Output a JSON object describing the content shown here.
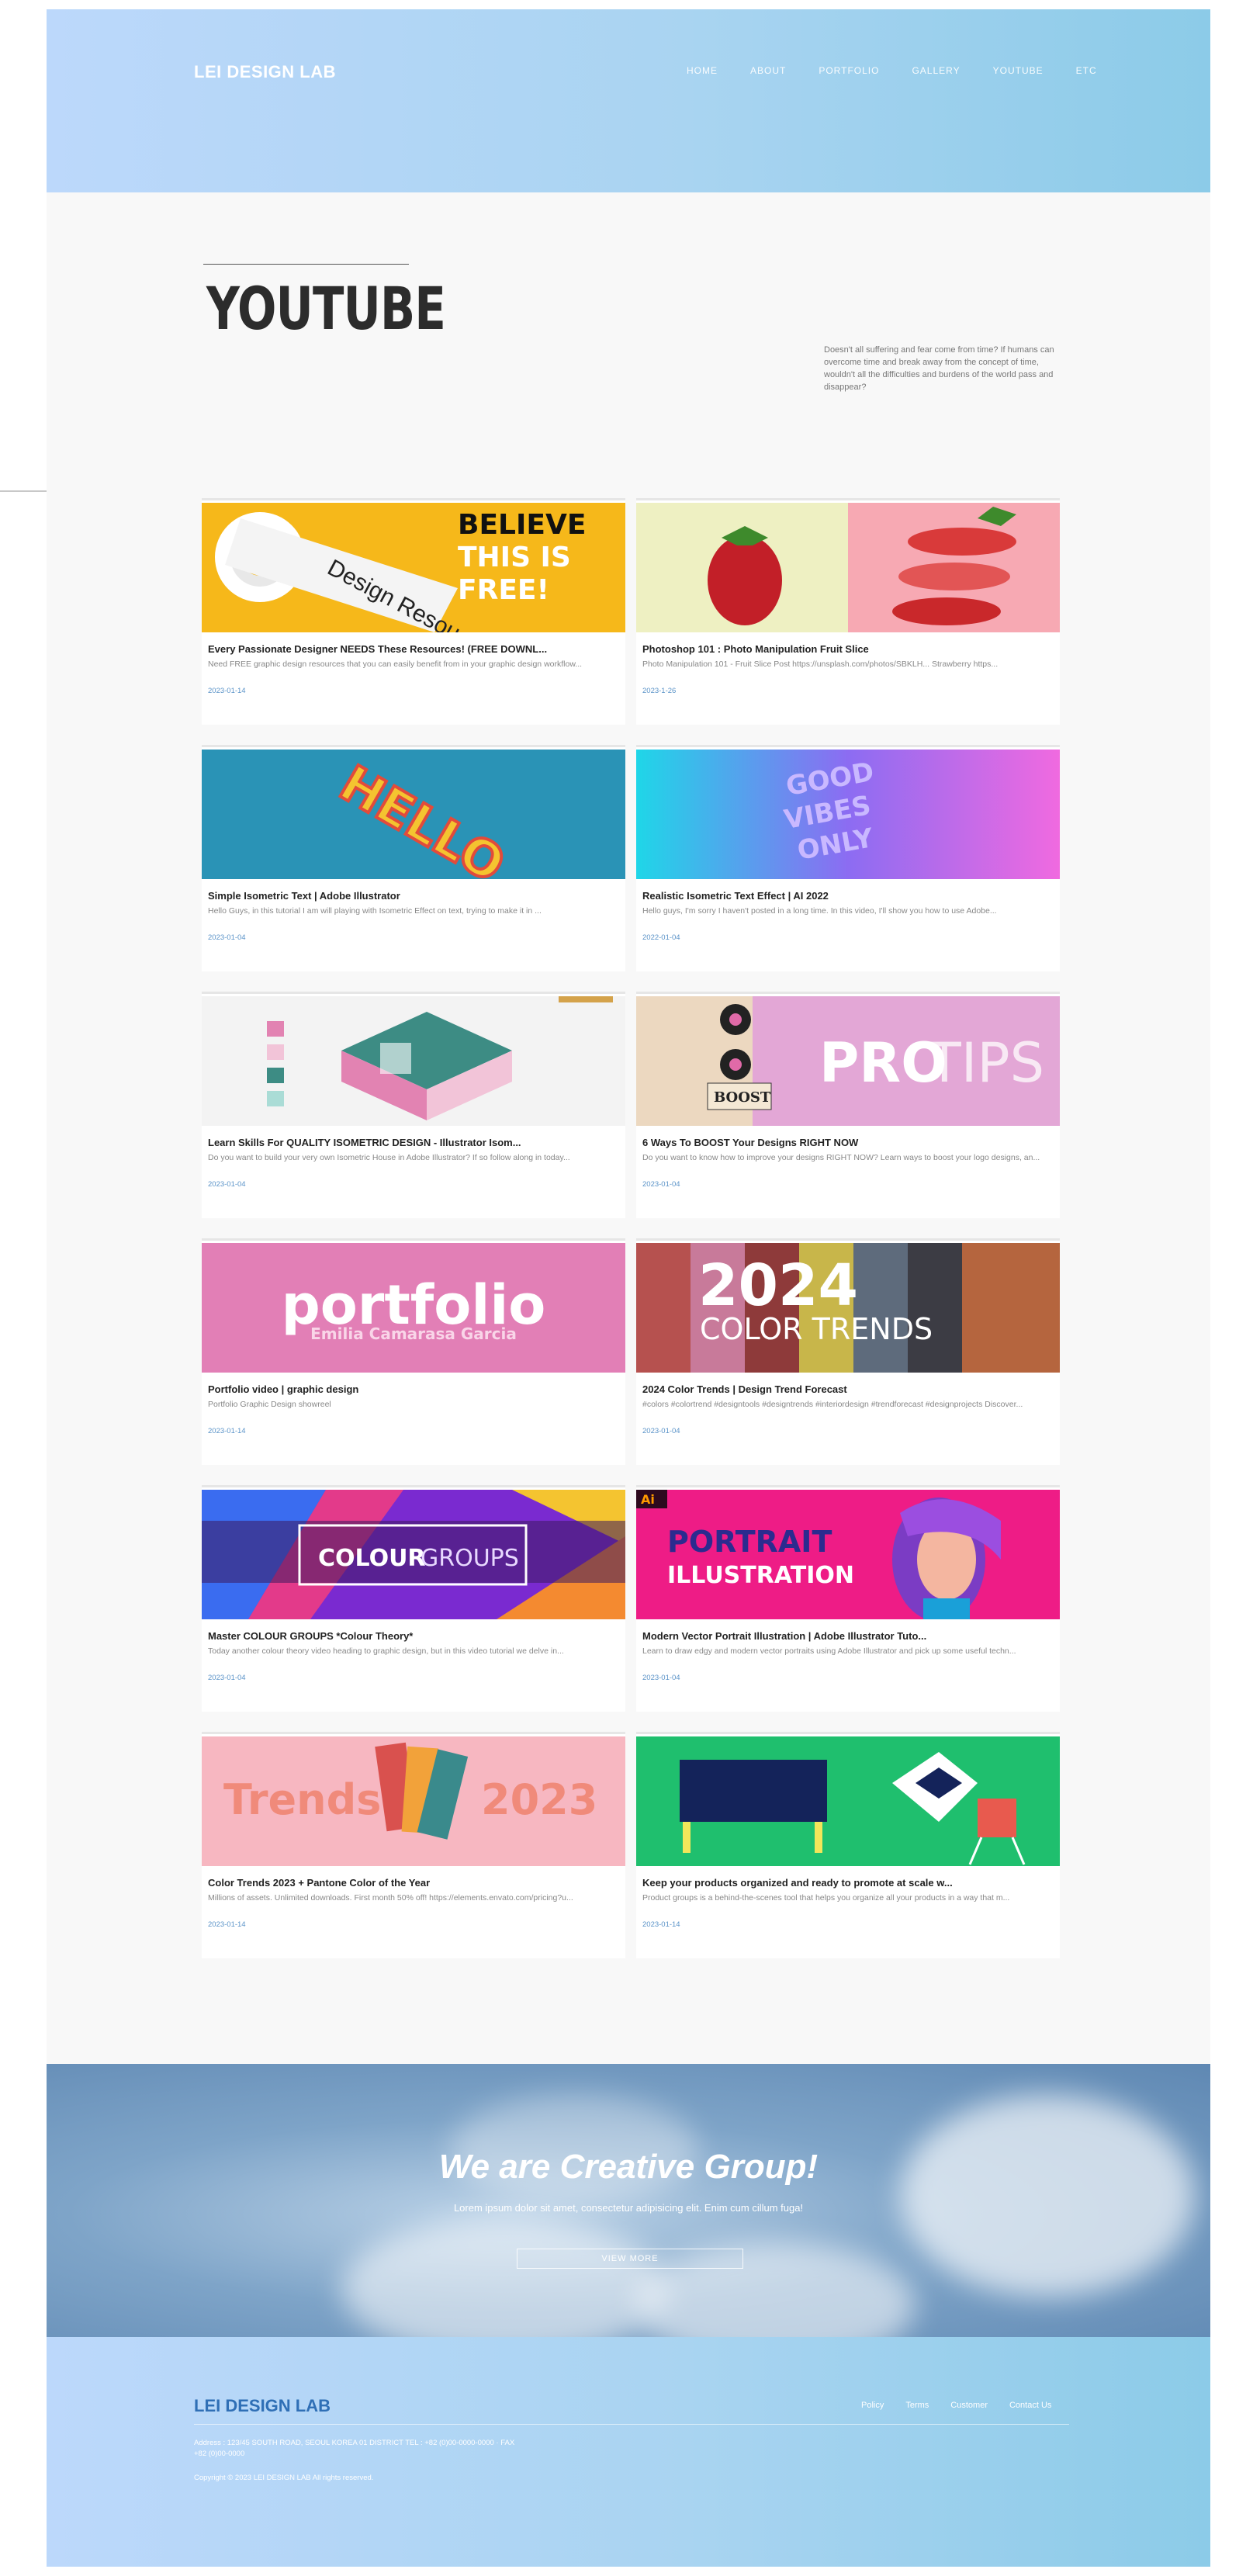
{
  "header": {
    "brand": "LEI DESIGN LAB",
    "nav": [
      "HOME",
      "ABOUT",
      "PORTFOLIO",
      "GALLERY",
      "YOUTUBE",
      "ETC"
    ]
  },
  "main": {
    "title": "YOUTUBE",
    "intro": "Doesn't all suffering and fear come from time? If humans can overcome time and break away from the concept of time, wouldn't all the difficulties and burdens of the world pass and disappear?"
  },
  "videos": [
    {
      "title": "Every Passionate Designer NEEDS These Resources! (FREE DOWNL...",
      "desc": "Need FREE graphic design resources that you can easily benefit from in your graphic design workflow...",
      "date": "2023-01-14",
      "thumb_text": [
        "BELIEVE",
        "THIS IS",
        "FREE!"
      ]
    },
    {
      "title": "Photoshop 101 : Photo Manipulation Fruit Slice",
      "desc": "Photo Manipulation 101 - Fruit Slice Post https://unsplash.com/photos/SBKLH... Strawberry https...",
      "date": "2023-1-26",
      "thumb_text": []
    },
    {
      "title": "Simple Isometric Text | Adobe Illustrator",
      "desc": "Hello Guys, in this tutorial I am will playing with Isometric Effect on text, trying to make it in ...",
      "date": "2023-01-04",
      "thumb_text": [
        "HELLO"
      ]
    },
    {
      "title": "Realistic Isometric Text Effect | AI 2022",
      "desc": "Hello guys, I'm sorry I haven't posted in a long time. In this video, I'll show you how to use Adobe...",
      "date": "2022-01-04",
      "thumb_text": [
        "GOOD",
        "VIBES",
        "ONLY"
      ]
    },
    {
      "title": "Learn Skills For QUALITY ISOMETRIC DESIGN - Illustrator Isom...",
      "desc": "Do you want to build your very own Isometric House in Adobe Illustrator? If so follow along in today...",
      "date": "2023-01-04",
      "thumb_text": []
    },
    {
      "title": "6 Ways To BOOST Your Designs RIGHT NOW",
      "desc": "Do you want to know how to improve your designs RIGHT NOW? Learn ways to boost your logo designs, an...",
      "date": "2023-01-04",
      "thumb_text": [
        "PRO",
        "TIPS",
        "BOOST"
      ]
    },
    {
      "title": "Portfolio video | graphic design",
      "desc": "Portfolio Graphic Design showreel",
      "date": "2023-01-14",
      "thumb_text": [
        "portfolio",
        "Emilia Camarasa Garcia"
      ]
    },
    {
      "title": "2024 Color Trends | Design Trend Forecast",
      "desc": "#colors #colortrend #designtools #designtrends #interiordesign #trendforecast #designprojects Discover...",
      "date": "2023-01-04",
      "thumb_text": [
        "2024",
        "COLOR TRENDS"
      ]
    },
    {
      "title": "Master COLOUR GROUPS *Colour Theory*",
      "desc": "Today another colour theory video heading to graphic design, but in this video tutorial we delve in...",
      "date": "2023-01-04",
      "thumb_text": [
        "COLOUR",
        "GROUPS"
      ]
    },
    {
      "title": "Modern Vector Portrait Illustration | Adobe Illustrator Tuto...",
      "desc": "Learn to draw edgy and modern vector portraits using Adobe Illustrator and pick up some useful techn...",
      "date": "2023-01-04",
      "thumb_text": [
        "Ai",
        "PORTRAIT",
        "ILLUSTRATION"
      ]
    },
    {
      "title": "Color Trends 2023 + Pantone Color of the Year",
      "desc": "Millions of assets. Unlimited downloads. First month 50% off! https://elements.envato.com/pricing?u...",
      "date": "2023-01-14",
      "thumb_text": [
        "Trends",
        "2023"
      ]
    },
    {
      "title": "Keep your products organized and ready to promote at scale w...",
      "desc": "Product groups is a behind-the-scenes tool that helps you organize all your products in a way that m...",
      "date": "2023-01-14",
      "thumb_text": []
    }
  ],
  "banner": {
    "title": "We are Creative Group!",
    "subtitle": "Lorem ipsum dolor sit amet, consectetur adipisicing elit. Enim cum cillum fuga!",
    "button": "VIEW MORE"
  },
  "footer": {
    "brand": "LEI DESIGN LAB",
    "nav": [
      "Policy",
      "Terms",
      "Customer",
      "Contact Us"
    ],
    "info": "Address : 123/45 SOUTH ROAD, SEOUL KOREA 01 DISTRICT TEL : +82 (0)00-0000-0000 · FAX +82 (0)00-0000",
    "copyright": "Copyright © 2023 LEI DESIGN LAB All rights reserved."
  },
  "colors": {
    "header_gradient_start": "#bcd8fb",
    "header_gradient_end": "#8ccbe8",
    "link_blue": "#5a93c8",
    "footer_brand": "#2f6fb6"
  }
}
